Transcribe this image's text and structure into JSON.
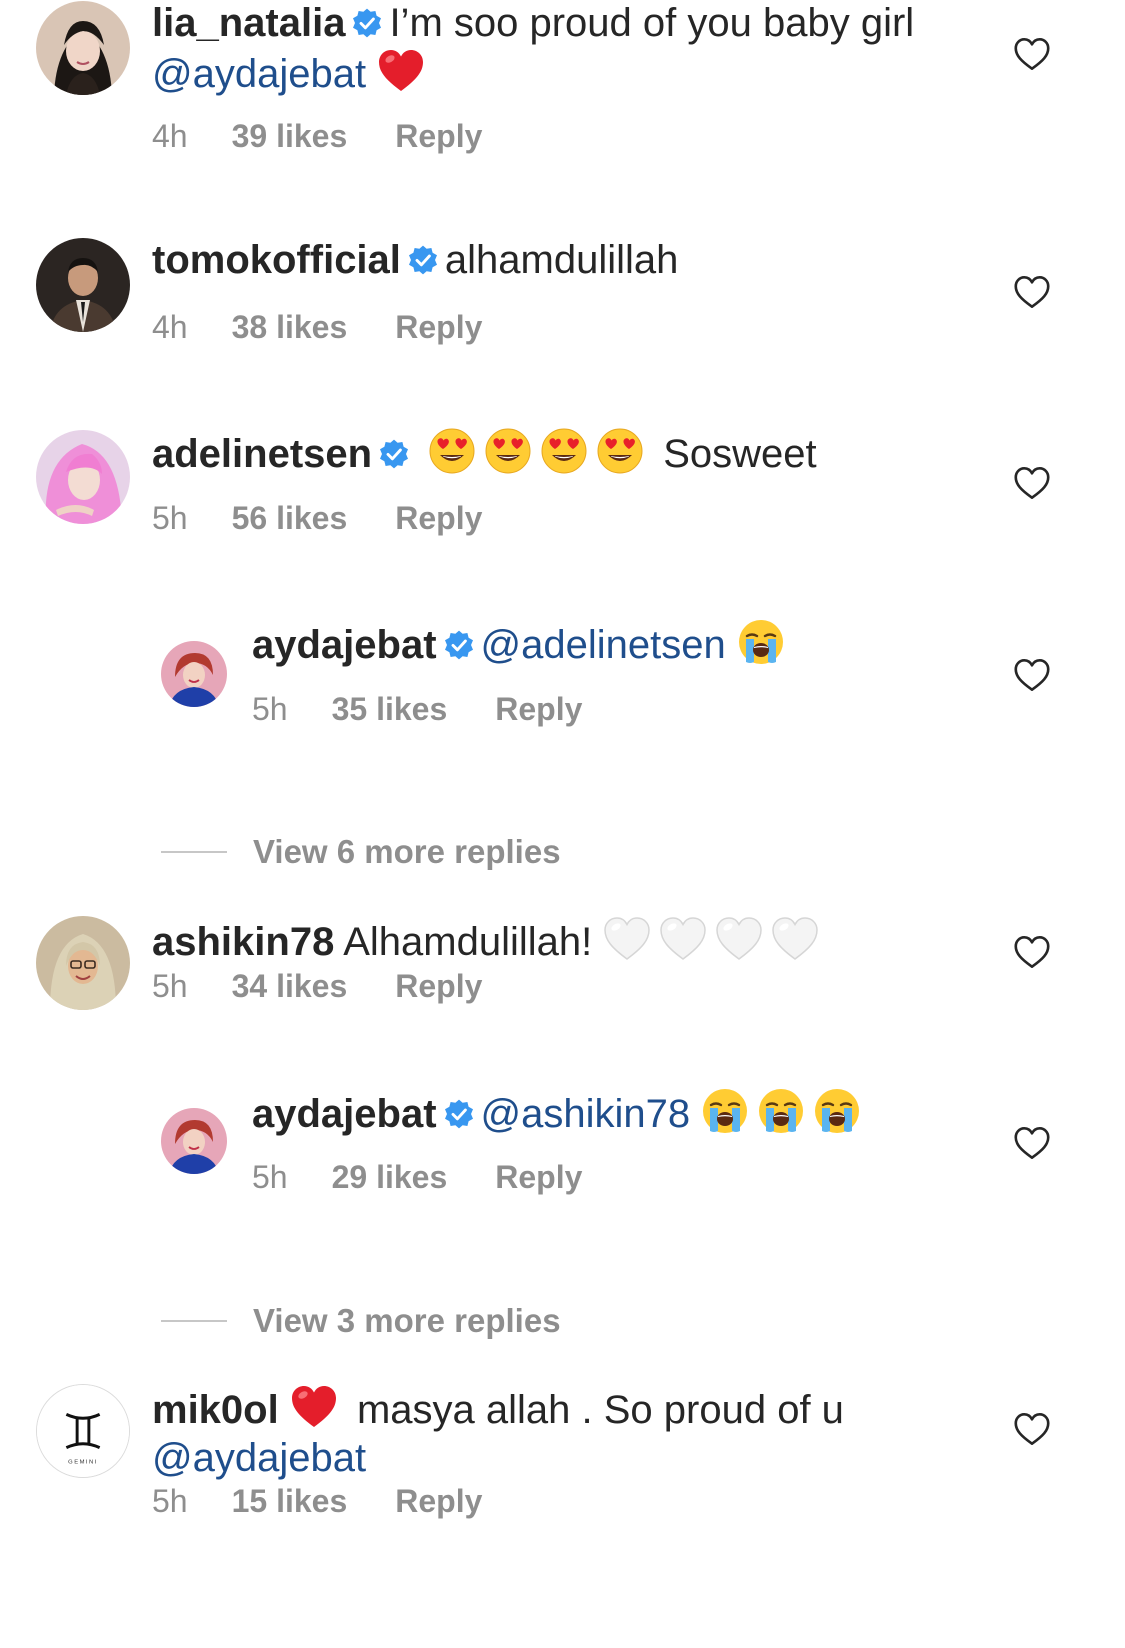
{
  "colors": {
    "text": "#262626",
    "secondary": "#8e8e8e",
    "mention": "#1f4e8c",
    "verified": "#3897f0"
  },
  "comments": [
    {
      "username": "lia_natalia",
      "verified": true,
      "text": "I’m soo proud of you baby girl",
      "mention": "@aydajebat",
      "emoji": "red-heart",
      "time": "4h",
      "likes": "39 likes",
      "reply": "Reply",
      "is_reply": false
    },
    {
      "username": "tomokofficial",
      "verified": true,
      "text": "alhamdulillah",
      "time": "4h",
      "likes": "38 likes",
      "reply": "Reply",
      "is_reply": false
    },
    {
      "username": "adelinetsen",
      "verified": true,
      "emojis": [
        "heart-eyes",
        "heart-eyes",
        "heart-eyes",
        "heart-eyes"
      ],
      "text": "Sosweet",
      "time": "5h",
      "likes": "56 likes",
      "reply": "Reply",
      "is_reply": false
    },
    {
      "username": "aydajebat",
      "verified": true,
      "mention": "@adelinetsen",
      "emojis": [
        "loudly-crying"
      ],
      "time": "5h",
      "likes": "35 likes",
      "reply": "Reply",
      "is_reply": true
    },
    {
      "username": "ashikin78",
      "verified": false,
      "text": "Alhamdulillah!",
      "emojis": [
        "white-heart",
        "white-heart",
        "white-heart",
        "white-heart"
      ],
      "time": "5h",
      "likes": "34 likes",
      "reply": "Reply",
      "is_reply": false
    },
    {
      "username": "aydajebat",
      "verified": true,
      "mention": "@ashikin78",
      "emojis": [
        "loudly-crying",
        "loudly-crying",
        "loudly-crying"
      ],
      "time": "5h",
      "likes": "29 likes",
      "reply": "Reply",
      "is_reply": true
    },
    {
      "username": "mik0ol",
      "verified": false,
      "emoji_after_name": "red-heart",
      "text": "masya allah . So proud of u",
      "mention": "@aydajebat",
      "time": "5h",
      "likes": "15 likes",
      "reply": "Reply",
      "is_reply": false,
      "avatar_text": "GEMINI"
    }
  ],
  "view_more": [
    {
      "label": "View 6 more replies"
    },
    {
      "label": "View 3 more replies"
    }
  ]
}
